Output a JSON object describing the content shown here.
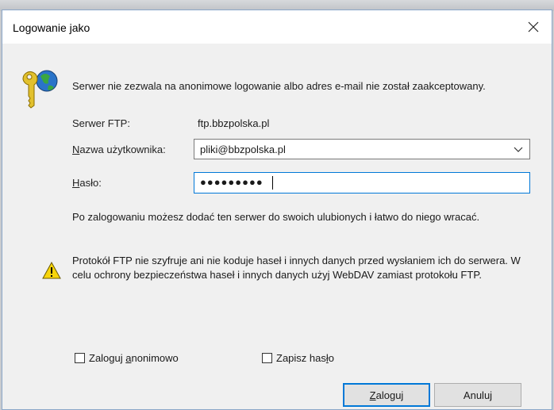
{
  "dialog": {
    "title": "Logowanie jako",
    "info": "Serwer nie zezwala na anonimowe logowanie albo adres e-mail nie został zaakceptowany.",
    "server_label": "Serwer FTP:",
    "server_value": "ftp.bbzpolska.pl",
    "username": {
      "label_pre": "N",
      "label_rest": "azwa użytkownika:",
      "value": "pliki@bbzpolska.pl"
    },
    "password": {
      "label_pre": "H",
      "label_rest": "asło:",
      "masked_value": "●●●●●●●●●"
    },
    "after_login_text": "Po zalogowaniu możesz dodać ten serwer do swoich ulubionych i łatwo do niego wracać.",
    "warning_text": "Protokół FTP nie szyfruje ani nie koduje haseł i innych danych przed wysłaniem ich do serwera. W celu ochrony bezpieczeństwa haseł i innych danych użyj WebDAV zamiast protokołu FTP.",
    "anonymous_checkbox": {
      "pre": "Zaloguj ",
      "ul": "a",
      "post": "nonimowo",
      "checked": false
    },
    "save_password_checkbox": {
      "pre": "Zapisz has",
      "ul": "ł",
      "post": "o",
      "checked": false
    },
    "login_button": {
      "ul": "Z",
      "rest": "aloguj"
    },
    "cancel_button": "Anuluj"
  },
  "colors": {
    "accent": "#0078d7",
    "dialog_bg": "#f0f0f0",
    "warning_yellow": "#f7d40a"
  },
  "icons": {
    "title_close": "close-icon",
    "header": "keys-globe-icon",
    "warning": "warning-icon",
    "dropdown": "chevron-down-icon"
  }
}
